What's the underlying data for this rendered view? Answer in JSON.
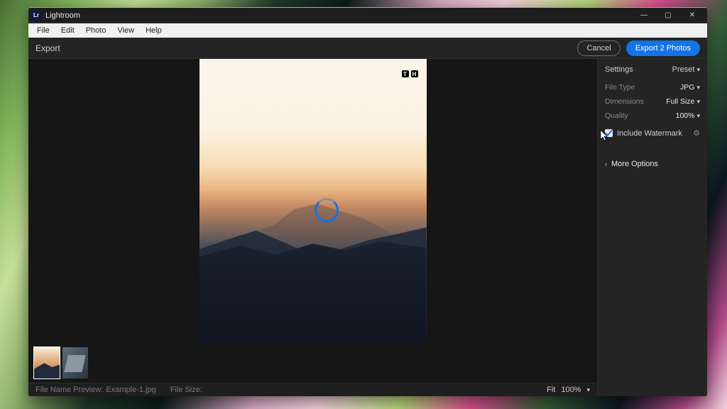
{
  "app": {
    "name": "Lightroom"
  },
  "window_controls": {
    "min": "—",
    "max": "▢",
    "close": "✕"
  },
  "menu": {
    "file": "File",
    "edit": "Edit",
    "photo": "Photo",
    "view": "View",
    "help": "Help"
  },
  "toolbar": {
    "title": "Export",
    "cancel": "Cancel",
    "export": "Export 2 Photos"
  },
  "watermark_text": {
    "a": "T",
    "b": "H"
  },
  "status": {
    "filename_label": "File Name Preview:",
    "filename_value": "Example-1.jpg",
    "filesize_label": "File Size:",
    "fit_label": "Fit",
    "zoom": "100%"
  },
  "panel": {
    "header": "Settings",
    "preset": "Preset",
    "rows": {
      "filetype_label": "File Type",
      "filetype_value": "JPG",
      "dimensions_label": "Dimensions",
      "dimensions_value": "Full Size",
      "quality_label": "Quality",
      "quality_value": "100%"
    },
    "watermark_label": "Include Watermark",
    "more_options": "More Options"
  }
}
